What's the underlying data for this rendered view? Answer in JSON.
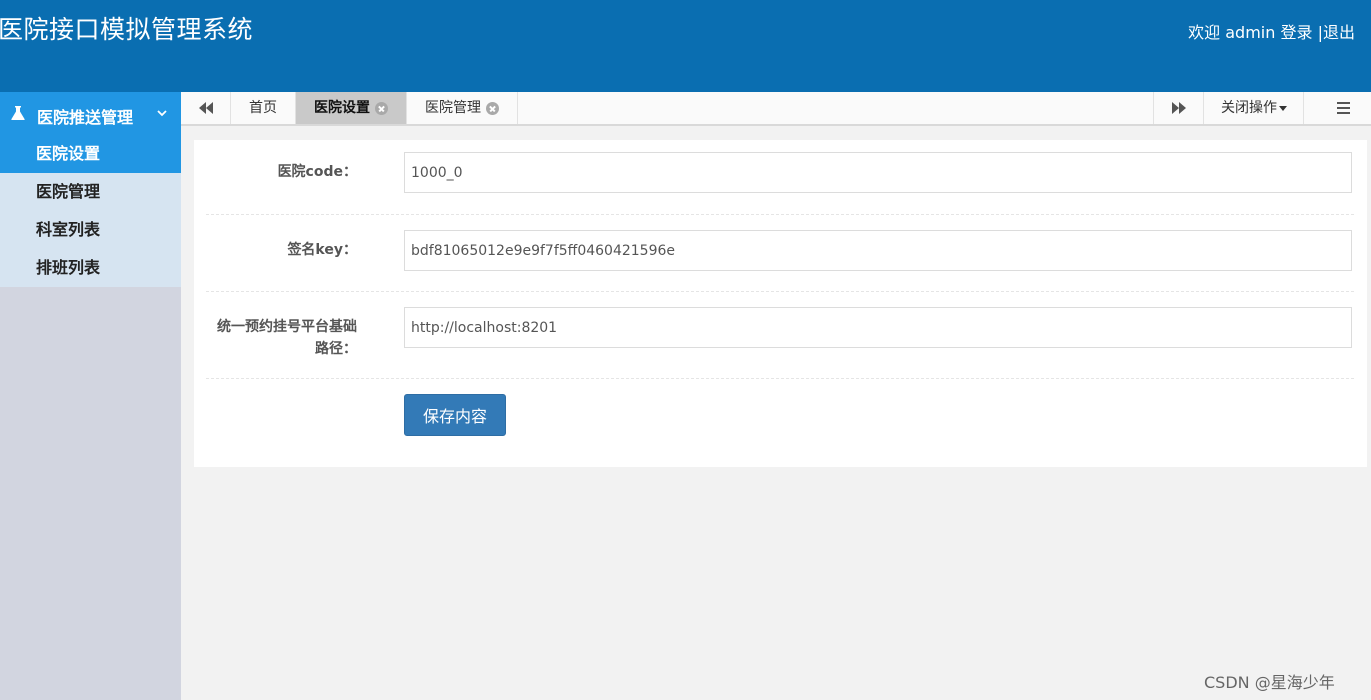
{
  "header": {
    "title": "医院接口模拟管理系统",
    "welcome": "欢迎",
    "username": "admin",
    "login": "登录",
    "separator": "|",
    "logout": "退出"
  },
  "sidebar": {
    "group_label": "医院推送管理",
    "group_icon": "flask-icon",
    "items": [
      {
        "label": "医院设置",
        "active": true
      },
      {
        "label": "医院管理",
        "active": false
      },
      {
        "label": "科室列表",
        "active": false
      },
      {
        "label": "排班列表",
        "active": false
      }
    ]
  },
  "tabs": {
    "items": [
      {
        "label": "首页",
        "closable": false,
        "active": false
      },
      {
        "label": "医院设置",
        "closable": true,
        "active": true
      },
      {
        "label": "医院管理",
        "closable": true,
        "active": false
      }
    ],
    "close_ops_label": "关闭操作"
  },
  "form": {
    "fields": [
      {
        "label": "医院code：",
        "value": "1000_0"
      },
      {
        "label": "签名key：",
        "value": "bdf81065012e9e9f7f5ff0460421596e"
      },
      {
        "label": "统一预约挂号平台基础路径：",
        "value": "http://localhost:8201"
      }
    ],
    "save_label": "保存内容"
  },
  "watermark": "CSDN @星海少年",
  "colors": {
    "header_bg": "#0a6eb1",
    "sidebar_active": "#2196e3",
    "button": "#337ab7"
  }
}
